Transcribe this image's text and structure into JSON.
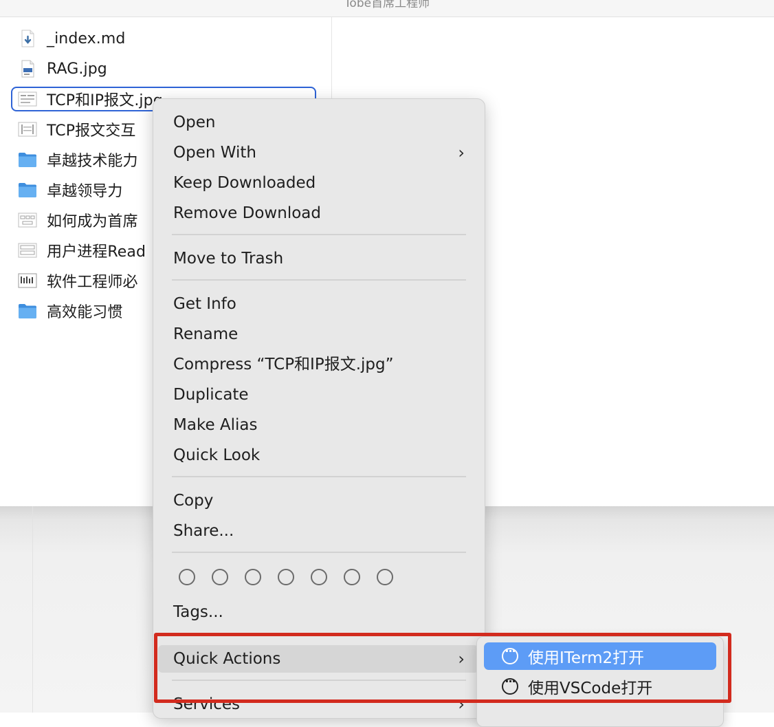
{
  "window": {
    "title": "Tobe首席工程师"
  },
  "files": [
    {
      "name": "_index.md",
      "icon": "markdown-file-icon"
    },
    {
      "name": "RAG.jpg",
      "icon": "image-file-icon"
    },
    {
      "name": "TCP和IP报文.jpg",
      "icon": "image-file-icon",
      "selected": true
    },
    {
      "name": "TCP报文交互",
      "icon": "image-file-icon"
    },
    {
      "name": "卓越技术能力",
      "icon": "folder-icon"
    },
    {
      "name": "卓越领导力",
      "icon": "folder-icon"
    },
    {
      "name": "如何成为首席",
      "icon": "image-file-icon"
    },
    {
      "name": "用户进程Read",
      "icon": "image-file-icon"
    },
    {
      "name": "软件工程师必",
      "icon": "image-file-icon"
    },
    {
      "name": "高效能习惯",
      "icon": "folder-icon"
    }
  ],
  "context_menu": {
    "open": "Open",
    "open_with": "Open With",
    "keep_downloaded": "Keep Downloaded",
    "remove_download": "Remove Download",
    "move_to_trash": "Move to Trash",
    "get_info": "Get Info",
    "rename": "Rename",
    "compress": "Compress “TCP和IP报文.jpg”",
    "duplicate": "Duplicate",
    "make_alias": "Make Alias",
    "quick_look": "Quick Look",
    "copy": "Copy",
    "share": "Share...",
    "tags": "Tags...",
    "quick_actions": "Quick Actions",
    "services": "Services",
    "submenu_arrow": "›"
  },
  "quick_actions_submenu": {
    "items": [
      {
        "label": "使用ITerm2打开",
        "icon": "ellipsis-circle-icon",
        "highlighted": true
      },
      {
        "label": "使用VSCode打开",
        "icon": "ellipsis-circle-icon",
        "highlighted": false
      }
    ]
  },
  "colors": {
    "selection_border": "#2e63d6",
    "submenu_highlight": "#5d9cf6",
    "annotation_red": "#d22b1e",
    "folder_blue": "#5aa9f0"
  }
}
